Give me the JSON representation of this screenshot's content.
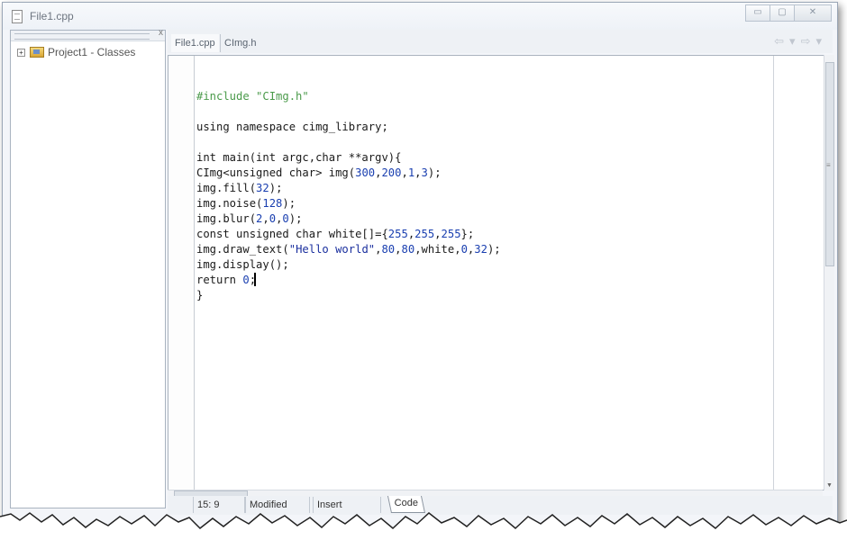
{
  "window": {
    "title": "File1.cpp",
    "buttons": {
      "minimize": "▭",
      "maximize": "▢",
      "close": "✕"
    }
  },
  "sidebar": {
    "close_glyph": "x",
    "tree": [
      {
        "label": "Project1 - Classes",
        "expander": "+",
        "icon": "project-folder-icon"
      }
    ]
  },
  "tabs": [
    {
      "label": "File1.cpp",
      "active": true
    },
    {
      "label": "CImg.h",
      "active": false
    }
  ],
  "nav": {
    "back": "⇦",
    "dropdown": "▾",
    "forward": "⇨"
  },
  "editor": {
    "lines": [
      {
        "text": "",
        "segments": []
      },
      {
        "segments": [
          {
            "t": "#include \"CImg.h\"",
            "c": "pp"
          }
        ]
      },
      {
        "segments": []
      },
      {
        "segments": [
          {
            "t": "using namespace cimg_library;"
          }
        ]
      },
      {
        "segments": []
      },
      {
        "segments": [
          {
            "t": "int main(int argc,char **argv){"
          }
        ]
      },
      {
        "segments": [
          {
            "t": "CImg<unsigned char> img("
          },
          {
            "t": "300",
            "c": "num"
          },
          {
            "t": ","
          },
          {
            "t": "200",
            "c": "num"
          },
          {
            "t": ","
          },
          {
            "t": "1",
            "c": "num"
          },
          {
            "t": ","
          },
          {
            "t": "3",
            "c": "num"
          },
          {
            "t": ");"
          }
        ]
      },
      {
        "segments": [
          {
            "t": "img.fill("
          },
          {
            "t": "32",
            "c": "num"
          },
          {
            "t": ");"
          }
        ]
      },
      {
        "segments": [
          {
            "t": "img.noise("
          },
          {
            "t": "128",
            "c": "num"
          },
          {
            "t": ");"
          }
        ]
      },
      {
        "segments": [
          {
            "t": "img.blur("
          },
          {
            "t": "2",
            "c": "num"
          },
          {
            "t": ","
          },
          {
            "t": "0",
            "c": "num"
          },
          {
            "t": ","
          },
          {
            "t": "0",
            "c": "num"
          },
          {
            "t": ");"
          }
        ]
      },
      {
        "segments": [
          {
            "t": "const unsigned char white[]={"
          },
          {
            "t": "255",
            "c": "num"
          },
          {
            "t": ","
          },
          {
            "t": "255",
            "c": "num"
          },
          {
            "t": ","
          },
          {
            "t": "255",
            "c": "num"
          },
          {
            "t": "};"
          }
        ]
      },
      {
        "segments": [
          {
            "t": "img.draw_text("
          },
          {
            "t": "\"Hello world\"",
            "c": "str"
          },
          {
            "t": ","
          },
          {
            "t": "80",
            "c": "num"
          },
          {
            "t": ","
          },
          {
            "t": "80",
            "c": "num"
          },
          {
            "t": ",white,"
          },
          {
            "t": "0",
            "c": "num"
          },
          {
            "t": ","
          },
          {
            "t": "32",
            "c": "num"
          },
          {
            "t": ");"
          }
        ]
      },
      {
        "segments": [
          {
            "t": "img.display();"
          }
        ]
      },
      {
        "segments": [
          {
            "t": "return "
          },
          {
            "t": "0",
            "c": "num"
          },
          {
            "t": ";"
          }
        ]
      },
      {
        "segments": [
          {
            "t": "}"
          }
        ]
      }
    ]
  },
  "statusbar": {
    "position": "15:  9",
    "state": "Modified",
    "mode": "Insert",
    "view_tab": "Code"
  },
  "colors": {
    "preprocessor": "#4a9a4a",
    "number": "#1a3fb0",
    "string": "#1a2f9e"
  }
}
